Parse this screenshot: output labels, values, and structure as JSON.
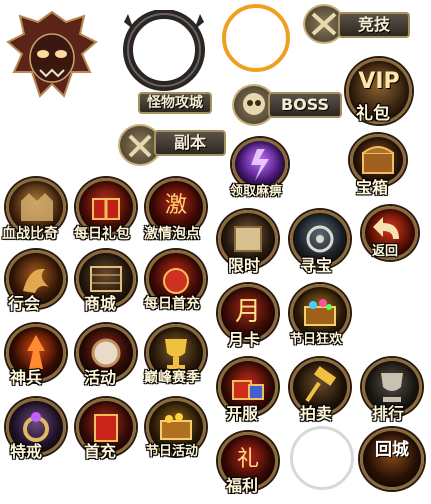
{
  "headers": {
    "monster_siege": "怪物攻城",
    "arena": "竞技",
    "boss": "BOSS",
    "vip_small": "VIP",
    "vip_gift": "礼包",
    "dungeon": "副本",
    "get_paralysis": "领取麻痹",
    "treasure_chest": "宝箱"
  },
  "icons": {
    "blood_battle": "血战比奇",
    "daily_gift": "每日礼包",
    "passion_bubble": "激情泡点",
    "guild": "行会",
    "shop": "商城",
    "daily_first_recharge": "每日首充",
    "divine_weapon": "神兵",
    "event": "活动",
    "peak_match": "巅峰赛季",
    "special_ring": "特戒",
    "first_recharge": "首充",
    "holiday_event": "节日活动",
    "limited_time": "限时",
    "treasure_hunt": "寻宝",
    "back": "返回",
    "monthly_card": "月卡",
    "holiday_carnival": "节日狂欢",
    "server_open": "开服",
    "auction": "拍卖",
    "ranking": "排行",
    "welfare": "福利",
    "return_city": "回城"
  },
  "glyphs": {
    "passion_char": "激",
    "welfare_char": "礼",
    "monthly_char": "月"
  },
  "colors": {
    "accent_gold": "#d9a24a",
    "ring_orange": "#f0a020",
    "label_text": "#fff6d8"
  }
}
